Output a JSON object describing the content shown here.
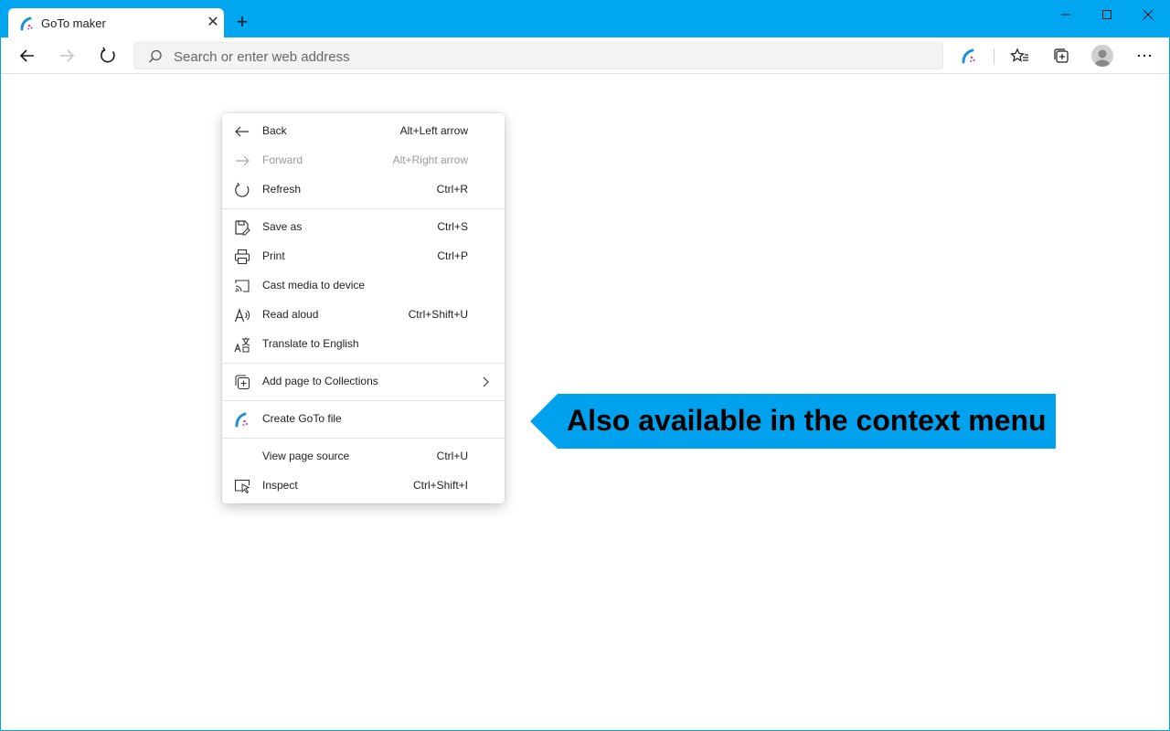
{
  "tab": {
    "title": "GoTo maker",
    "close": "✕"
  },
  "new_tab": "+",
  "address": {
    "placeholder": "Search or enter web address",
    "value": ""
  },
  "context_menu": {
    "items": [
      {
        "label": "Back",
        "shortcut": "Alt+Left arrow",
        "icon": "back-arrow-icon"
      },
      {
        "label": "Forward",
        "shortcut": "Alt+Right arrow",
        "icon": "forward-arrow-icon",
        "disabled": true
      },
      {
        "label": "Refresh",
        "shortcut": "Ctrl+R",
        "icon": "refresh-icon"
      },
      {
        "label": "Save as",
        "shortcut": "Ctrl+S",
        "icon": "save-as-icon"
      },
      {
        "label": "Print",
        "shortcut": "Ctrl+P",
        "icon": "printer-icon"
      },
      {
        "label": "Cast media to device",
        "shortcut": "",
        "icon": "cast-icon"
      },
      {
        "label": "Read aloud",
        "shortcut": "Ctrl+Shift+U",
        "icon": "read-aloud-icon"
      },
      {
        "label": "Translate to English",
        "shortcut": "",
        "icon": "translate-icon"
      },
      {
        "label": "Add page to Collections",
        "shortcut": "",
        "icon": "collections-icon"
      },
      {
        "label": "Create GoTo file",
        "shortcut": "",
        "icon": "goto-extension-icon"
      },
      {
        "label": "View page source",
        "shortcut": "Ctrl+U",
        "icon": ""
      },
      {
        "label": "Inspect",
        "shortcut": "Ctrl+Shift+I",
        "icon": "inspect-icon"
      }
    ]
  },
  "callout": {
    "text": "Also available in the context menu"
  },
  "colors": {
    "accent": "#00a6f0",
    "callout": "#00a2ed",
    "extension_icon": "#1e90d8"
  }
}
